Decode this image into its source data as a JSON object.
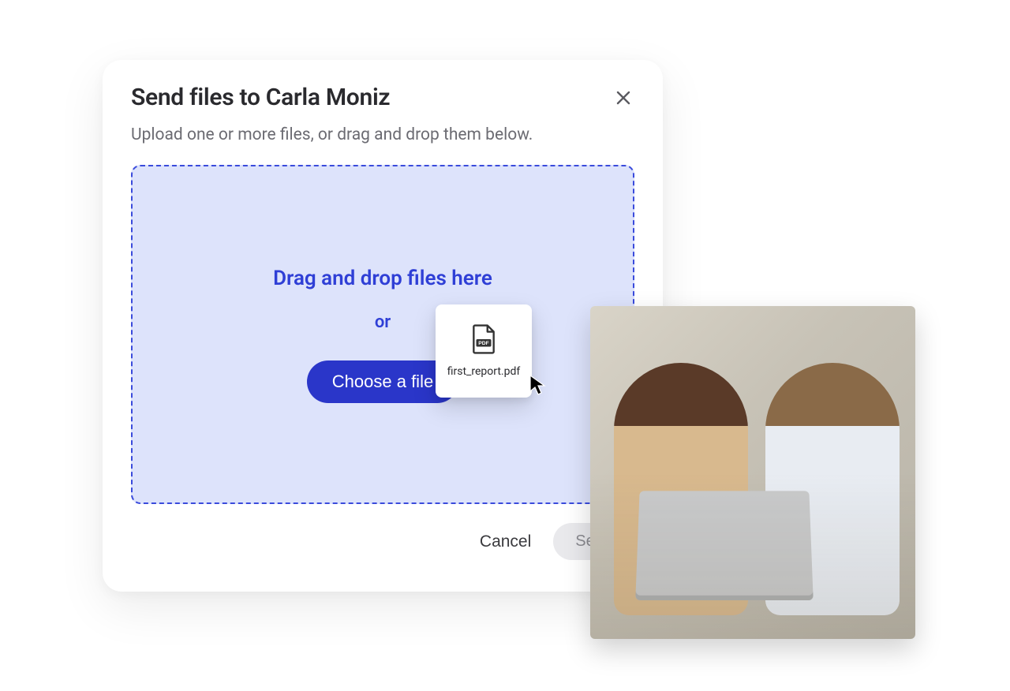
{
  "modal": {
    "title": "Send files to Carla Moniz",
    "subtitle": "Upload one or more files, or drag and drop them below.",
    "dropzone": {
      "heading": "Drag and drop files here",
      "or": "or",
      "choose_label": "Choose a file"
    },
    "footer": {
      "cancel_label": "Cancel",
      "send_label": "Send"
    }
  },
  "dragged_file": {
    "name": "first_report.pdf",
    "type": "pdf"
  },
  "colors": {
    "accent": "#2a36c9",
    "dropzone_bg": "#dde3fb",
    "dropzone_border": "#3a4bdc"
  }
}
